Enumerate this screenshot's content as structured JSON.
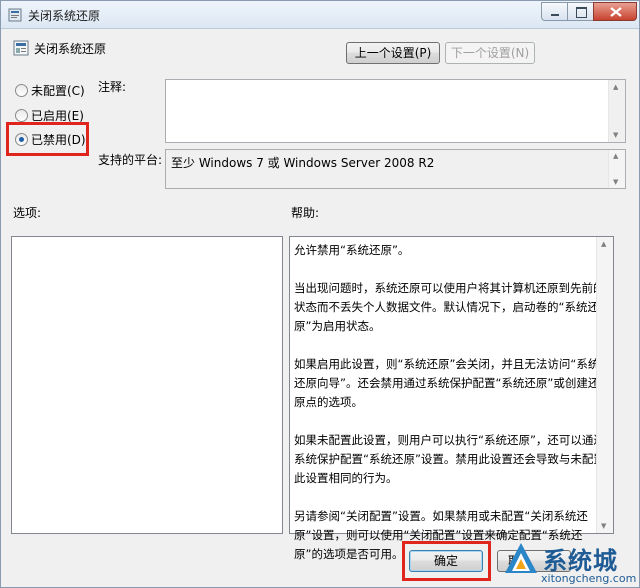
{
  "window": {
    "title": "关闭系统还原",
    "heading": "关闭系统还原"
  },
  "nav": {
    "prev_label": "上一个设置(P)",
    "next_label": "下一个设置(N)"
  },
  "state": {
    "options": [
      {
        "label": "未配置(C)",
        "checked": false
      },
      {
        "label": "已启用(E)",
        "checked": false
      },
      {
        "label": "已禁用(D)",
        "checked": true
      }
    ]
  },
  "comment": {
    "label": "注释:",
    "value": ""
  },
  "platform": {
    "label": "支持的平台:",
    "value": "至少 Windows 7 或 Windows Server 2008 R2"
  },
  "options_pane": {
    "label": "选项:"
  },
  "help_pane": {
    "label": "帮助:",
    "paragraphs": [
      "允许禁用“系统还原”。",
      "当出现问题时，系统还原可以使用户将其计算机还原到先前的状态而不丢失个人数据文件。默认情况下，启动卷的“系统还原”为启用状态。",
      "如果启用此设置，则“系统还原”会关闭，并且无法访问“系统还原向导”。还会禁用通过系统保护配置“系统还原”或创建还原点的选项。",
      "如果未配置此设置，则用户可以执行“系统还原”，还可以通过系统保护配置“系统还原”设置。禁用此设置还会导致与未配置此设置相同的行为。",
      "另请参阅“关闭配置”设置。如果禁用或未配置“关闭系统还原”设置，则可以使用“关闭配置”设置来确定配置“系统还原”的选项是否可用。"
    ]
  },
  "footer": {
    "ok_label": "确定",
    "cancel_label": "取"
  },
  "watermark": {
    "brand": "系统城",
    "url": "xitongcheng.com"
  },
  "colors": {
    "highlight": "#e0261c",
    "accent": "#1e5fa8"
  }
}
